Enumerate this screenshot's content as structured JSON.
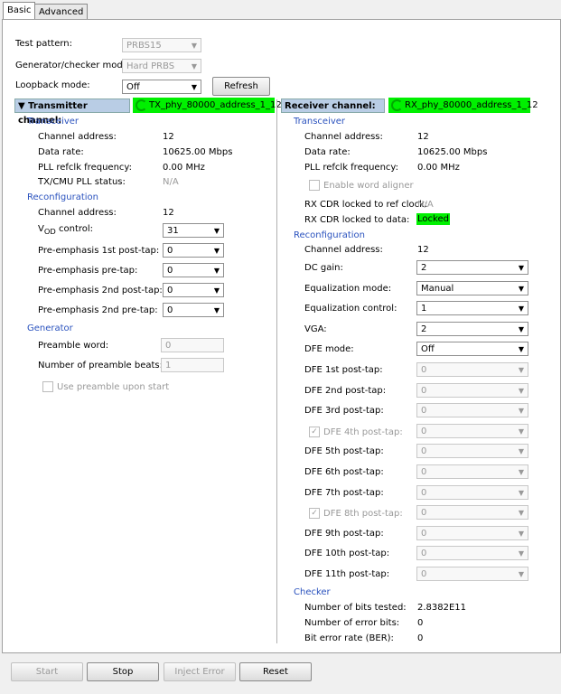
{
  "tabs": [
    "Basic",
    "Advanced"
  ],
  "top": {
    "test_pattern_label": "Test pattern:",
    "test_pattern": "PRBS15",
    "gen_mode_label": "Generator/checker mode:",
    "gen_mode": "Hard PRBS",
    "loopback_label": "Loopback mode:",
    "loopback": "Off",
    "refresh": "Refresh"
  },
  "tx": {
    "header": "Transmitter channel:",
    "channel": "TX_phy_80000_address_1_12",
    "transceiver": "Transceiver",
    "channel_address_label": "Channel address:",
    "channel_address": "12",
    "data_rate_label": "Data rate:",
    "data_rate": "10625.00 Mbps",
    "pll_label": "PLL refclk frequency:",
    "pll": "0.00 MHz",
    "cmu_label": "TX/CMU PLL status:",
    "cmu": "N/A",
    "reconfiguration": "Reconfiguration",
    "rc_channel_label": "Channel address:",
    "rc_channel": "12",
    "vod_label_v": "V",
    "vod_label_sub": "OD",
    "vod_label_rest": " control:",
    "vod": "31",
    "pe1_label": "Pre-emphasis 1st post-tap:",
    "pe1": "0",
    "pep_label": "Pre-emphasis pre-tap:",
    "pep": "0",
    "pe2_label": "Pre-emphasis 2nd post-tap:",
    "pe2": "0",
    "pe2p_label": "Pre-emphasis 2nd pre-tap:",
    "pe2p": "0",
    "generator": "Generator",
    "preamble_label": "Preamble word:",
    "preamble": "0",
    "beats_label": "Number of preamble beats:",
    "beats": "1",
    "use_preamble": "Use preamble upon start"
  },
  "rx": {
    "header": "Receiver channel:",
    "channel": "RX_phy_80000_address_1_12",
    "transceiver": "Transceiver",
    "channel_address_label": "Channel address:",
    "channel_address": "12",
    "data_rate_label": "Data rate:",
    "data_rate": "10625.00 Mbps",
    "pll_label": "PLL refclk frequency:",
    "pll": "0.00 MHz",
    "word_aligner": "Enable word aligner",
    "cdr_ref_label": "RX CDR locked to ref clock:",
    "cdr_ref": "N/A",
    "cdr_data_label": "RX CDR locked to data:",
    "cdr_data": "Locked",
    "reconfiguration": "Reconfiguration",
    "rc_channel_label": "Channel address:",
    "rc_channel": "12",
    "controls": [
      {
        "label": "DC gain:",
        "value": "2",
        "enabled": true
      },
      {
        "label": "Equalization mode:",
        "value": "Manual",
        "enabled": true
      },
      {
        "label": "Equalization control:",
        "value": "1",
        "enabled": true
      },
      {
        "label": "VGA:",
        "value": "2",
        "enabled": true
      },
      {
        "label": "DFE mode:",
        "value": "Off",
        "enabled": true
      },
      {
        "label": "DFE 1st post-tap:",
        "value": "0",
        "enabled": false
      },
      {
        "label": "DFE 2nd post-tap:",
        "value": "0",
        "enabled": false
      },
      {
        "label": "DFE 3rd post-tap:",
        "value": "0",
        "enabled": false
      },
      {
        "label": "DFE 4th post-tap:",
        "value": "0",
        "enabled": false,
        "checkbox": true
      },
      {
        "label": "DFE 5th post-tap:",
        "value": "0",
        "enabled": false
      },
      {
        "label": "DFE 6th post-tap:",
        "value": "0",
        "enabled": false
      },
      {
        "label": "DFE 7th post-tap:",
        "value": "0",
        "enabled": false
      },
      {
        "label": "DFE 8th post-tap:",
        "value": "0",
        "enabled": false,
        "checkbox": true
      },
      {
        "label": "DFE 9th post-tap:",
        "value": "0",
        "enabled": false
      },
      {
        "label": "DFE 10th post-tap:",
        "value": "0",
        "enabled": false
      },
      {
        "label": "DFE 11th post-tap:",
        "value": "0",
        "enabled": false
      }
    ],
    "checker": "Checker",
    "bits_label": "Number of bits tested:",
    "bits": "2.8382E11",
    "err_label": "Number of error bits:",
    "err": "0",
    "ber_label": "Bit error rate (BER):",
    "ber": "0"
  },
  "buttons": {
    "start": "Start",
    "stop": "Stop",
    "inject": "Inject Error",
    "reset": "Reset"
  }
}
